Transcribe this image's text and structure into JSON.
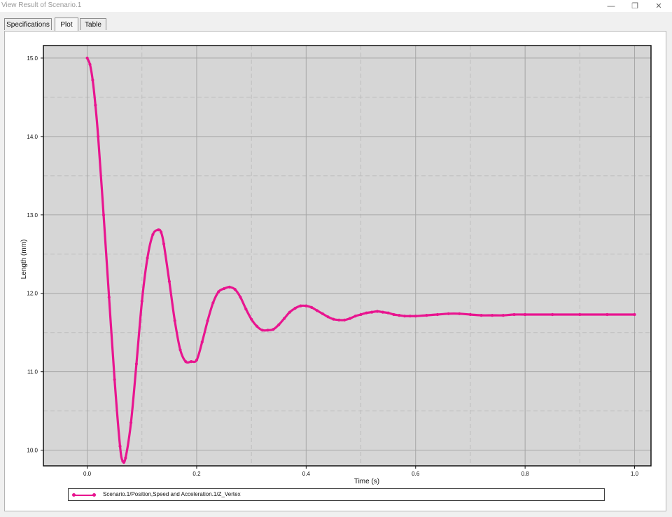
{
  "window": {
    "title": "View Result of Scenario.1",
    "buttons": {
      "minimize": "—",
      "restore": "❐",
      "close": "✕"
    }
  },
  "tabs": [
    {
      "label": "Specifications",
      "active": false
    },
    {
      "label": "Plot",
      "active": true
    },
    {
      "label": "Table",
      "active": false
    }
  ],
  "colors": {
    "series": "#e8158f",
    "plot_background": "#d6d6d6",
    "grid_major": "#a6a6a6",
    "grid_minor": "#bdbdbd"
  },
  "chart_data": {
    "type": "line",
    "title": "",
    "xlabel": "Time (s)",
    "ylabel": "Length (mm)",
    "xlim": [
      -0.08,
      1.03
    ],
    "ylim": [
      9.8,
      15.16
    ],
    "xticks": [
      "0.0",
      "0.2",
      "0.4",
      "0.6",
      "0.8",
      "1.0"
    ],
    "yticks": [
      "10.0",
      "11.0",
      "12.0",
      "13.0",
      "14.0",
      "15.0"
    ],
    "grid": true,
    "legend_position": "bottom",
    "series": [
      {
        "name": "Scenario.1/Position,Speed and Acceleration.1/Z_Vertex",
        "marker": "dot",
        "x": [
          0.0,
          0.005,
          0.01,
          0.015,
          0.02,
          0.03,
          0.04,
          0.05,
          0.06,
          0.065,
          0.07,
          0.08,
          0.09,
          0.1,
          0.11,
          0.12,
          0.13,
          0.135,
          0.14,
          0.15,
          0.16,
          0.17,
          0.18,
          0.19,
          0.2,
          0.21,
          0.22,
          0.23,
          0.24,
          0.25,
          0.26,
          0.27,
          0.28,
          0.29,
          0.3,
          0.31,
          0.32,
          0.33,
          0.34,
          0.35,
          0.36,
          0.37,
          0.38,
          0.39,
          0.4,
          0.41,
          0.42,
          0.43,
          0.44,
          0.45,
          0.46,
          0.47,
          0.48,
          0.49,
          0.5,
          0.51,
          0.52,
          0.53,
          0.54,
          0.55,
          0.56,
          0.57,
          0.58,
          0.59,
          0.6,
          0.62,
          0.64,
          0.66,
          0.68,
          0.7,
          0.72,
          0.74,
          0.76,
          0.78,
          0.8,
          0.85,
          0.9,
          0.95,
          1.0
        ],
        "y": [
          15.0,
          14.92,
          14.72,
          14.4,
          14.0,
          13.0,
          11.95,
          10.9,
          10.05,
          9.86,
          9.9,
          10.35,
          11.1,
          11.9,
          12.45,
          12.75,
          12.81,
          12.78,
          12.63,
          12.15,
          11.65,
          11.28,
          11.13,
          11.13,
          11.15,
          11.38,
          11.65,
          11.88,
          12.02,
          12.06,
          12.08,
          12.05,
          11.95,
          11.8,
          11.67,
          11.58,
          11.53,
          11.53,
          11.54,
          11.6,
          11.68,
          11.76,
          11.81,
          11.84,
          11.84,
          11.82,
          11.78,
          11.74,
          11.7,
          11.67,
          11.66,
          11.66,
          11.68,
          11.71,
          11.73,
          11.75,
          11.76,
          11.77,
          11.76,
          11.75,
          11.73,
          11.72,
          11.71,
          11.71,
          11.71,
          11.72,
          11.73,
          11.74,
          11.74,
          11.73,
          11.72,
          11.72,
          11.72,
          11.73,
          11.73,
          11.73,
          11.73,
          11.73,
          11.73
        ]
      }
    ]
  }
}
